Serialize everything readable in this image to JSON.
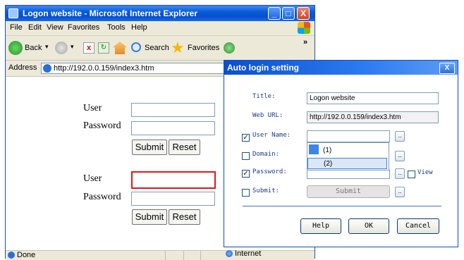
{
  "browser": {
    "title": "Logon website - Microsoft Internet Explorer",
    "caption_buttons": {
      "minimize": "_",
      "maximize": "□",
      "close": "X"
    },
    "menu": [
      "File",
      "Edit",
      "View",
      "Favorites",
      "Tools",
      "Help"
    ],
    "toolbar": {
      "back": "Back",
      "search": "Search",
      "favorites": "Favorites",
      "chevron": "»"
    },
    "address": {
      "label": "Address",
      "url": "http://192.0.0.159/index3.htm"
    },
    "status": {
      "left": "Done",
      "zone": "Internet"
    }
  },
  "page": {
    "form1": {
      "user_label": "User",
      "password_label": "Password",
      "submit": "Submit",
      "reset": "Reset"
    },
    "form2": {
      "user_label": "User",
      "password_label": "Password",
      "submit": "Submit",
      "reset": "Reset"
    }
  },
  "dialog": {
    "title": "Auto login setting",
    "close": "X",
    "title_label": "Title:",
    "title_value": "Logon website",
    "web_url_label": "Web URL:",
    "web_url_value": "http://192.0.0.159/index3.htm",
    "user_name_label": "User Name:",
    "domain_label": "Domain:",
    "password_label": "Password:",
    "submit_label": "Submit:",
    "submit_button": "Submit",
    "view_label": "View",
    "dots": "..",
    "dropdown_options": [
      "(1)",
      "(2)"
    ],
    "checkboxes": {
      "user_name": true,
      "domain": false,
      "password": true,
      "submit": false,
      "view": false
    },
    "check_mark": "✓",
    "buttons": {
      "help": "Help",
      "ok": "OK",
      "cancel": "Cancel"
    }
  },
  "colors": {
    "xp_blue": "#0a5ad8",
    "highlight": "#e01818",
    "dialog_label": "#1b3a8c"
  }
}
